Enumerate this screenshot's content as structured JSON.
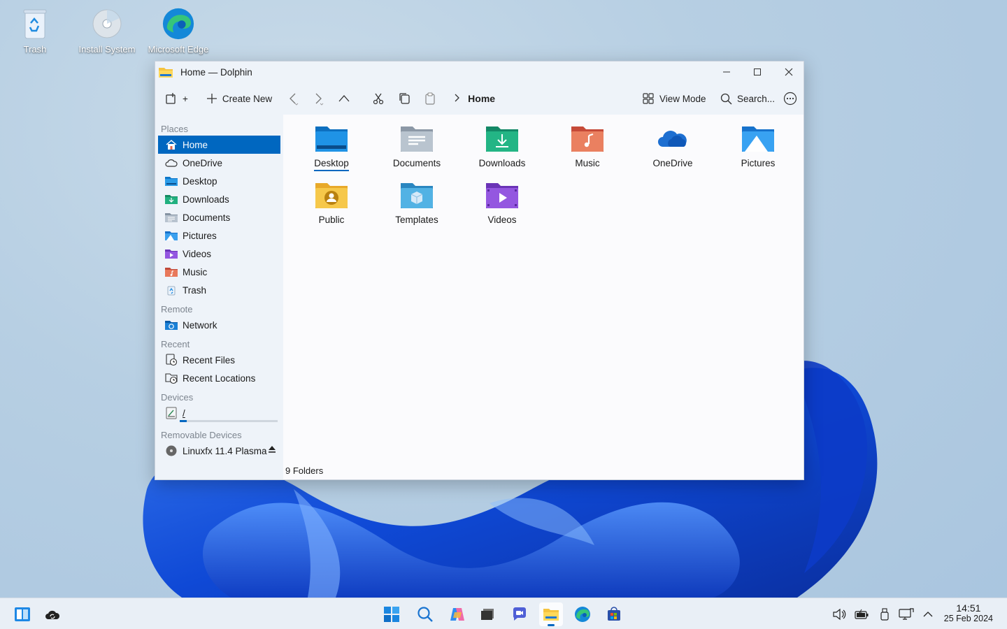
{
  "desktop": {
    "icons": [
      {
        "label": "Trash",
        "icon": "trash-icon"
      },
      {
        "label": "Install System",
        "icon": "install-disc-icon"
      },
      {
        "label": "Microsoft Edge",
        "icon": "edge-icon"
      }
    ]
  },
  "window": {
    "title": "Home — Dolphin",
    "controls": {
      "minimize": "minimize-icon",
      "maximize": "maximize-icon",
      "close": "close-icon"
    }
  },
  "toolbar": {
    "new_tab_suffix": "+",
    "create_new_label": "Create New",
    "breadcrumb_current": "Home",
    "view_mode_label": "View Mode",
    "search_label": "Search..."
  },
  "sidebar": {
    "sections": {
      "places": "Places",
      "remote": "Remote",
      "recent": "Recent",
      "devices": "Devices",
      "removable": "Removable Devices"
    },
    "places": [
      {
        "label": "Home",
        "icon": "home-icon",
        "active": true
      },
      {
        "label": "OneDrive",
        "icon": "cloud-icon"
      },
      {
        "label": "Desktop",
        "icon": "desktop-folder-icon"
      },
      {
        "label": "Downloads",
        "icon": "downloads-folder-icon"
      },
      {
        "label": "Documents",
        "icon": "documents-folder-icon"
      },
      {
        "label": "Pictures",
        "icon": "pictures-folder-icon"
      },
      {
        "label": "Videos",
        "icon": "videos-folder-icon"
      },
      {
        "label": "Music",
        "icon": "music-folder-icon"
      },
      {
        "label": "Trash",
        "icon": "trash-icon"
      }
    ],
    "remote": [
      {
        "label": "Network",
        "icon": "network-icon"
      }
    ],
    "recent": [
      {
        "label": "Recent Files",
        "icon": "recent-files-icon"
      },
      {
        "label": "Recent Locations",
        "icon": "recent-locations-icon"
      }
    ],
    "devices": [
      {
        "label": "/",
        "icon": "drive-icon",
        "usage": 0.07
      }
    ],
    "removable": [
      {
        "label": "Linuxfx 11.4 Plasma",
        "icon": "optical-disc-icon"
      }
    ]
  },
  "content": {
    "items": [
      {
        "label": "Desktop",
        "icon": "desktop-folder-icon",
        "color": "#1e88d8"
      },
      {
        "label": "Documents",
        "icon": "documents-folder-icon",
        "color": "#9aa7b6"
      },
      {
        "label": "Downloads",
        "icon": "downloads-folder-icon",
        "color": "#1fa87a"
      },
      {
        "label": "Music",
        "icon": "music-folder-icon",
        "color": "#e2674f"
      },
      {
        "label": "OneDrive",
        "icon": "onedrive-icon",
        "color": "#1d6fd1"
      },
      {
        "label": "Pictures",
        "icon": "pictures-folder-icon",
        "color": "#2a8fe0"
      },
      {
        "label": "Public",
        "icon": "public-folder-icon",
        "color": "#f3c33c"
      },
      {
        "label": "Templates",
        "icon": "templates-folder-icon",
        "color": "#4ba7d8"
      },
      {
        "label": "Videos",
        "icon": "videos-folder-icon",
        "color": "#8b4fd6"
      }
    ],
    "status": "9 Folders"
  },
  "taskbar": {
    "left": [
      {
        "icon": "panel-icon"
      },
      {
        "icon": "cloud-sync-icon"
      }
    ],
    "center": [
      {
        "icon": "start-windows-icon"
      },
      {
        "icon": "search-icon"
      },
      {
        "icon": "copilot-icon"
      },
      {
        "icon": "task-view-icon"
      },
      {
        "icon": "chat-icon"
      },
      {
        "icon": "file-manager-icon",
        "active": true
      },
      {
        "icon": "edge-icon"
      },
      {
        "icon": "store-icon"
      }
    ],
    "tray": [
      {
        "icon": "volume-icon"
      },
      {
        "icon": "battery-icon"
      },
      {
        "icon": "usb-icon"
      },
      {
        "icon": "network-display-icon"
      },
      {
        "icon": "chevron-up-icon"
      }
    ],
    "time": "14:51",
    "date": "25 Feb 2024"
  },
  "colors": {
    "accent": "#0067c0",
    "chrome": "#eef3f9"
  }
}
